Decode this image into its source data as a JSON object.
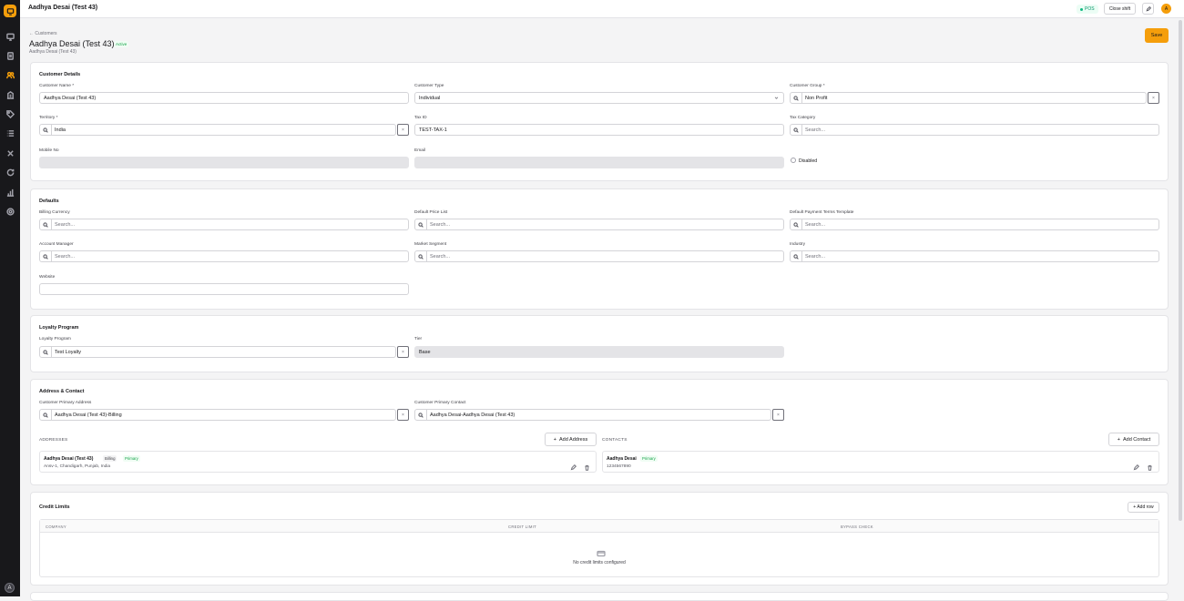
{
  "app": {
    "window_title": "Aadhya Desai (Test 43)",
    "pos_label": "POS",
    "close_shift": "Close shift",
    "avatar_initial": "A",
    "sidebar_avatar_initial": "A"
  },
  "sidebar": {
    "items": [
      "monitor-icon",
      "document-icon",
      "users-icon",
      "building-icon",
      "tag-icon",
      "list-icon",
      "tools-icon",
      "refresh-icon",
      "bar-chart-icon",
      "settings-icon"
    ],
    "active": "users-icon"
  },
  "header": {
    "breadcrumb": "← Customers",
    "title": "Aadhya Desai (Test 43)",
    "status": "Active",
    "subtitle": "Aadhya Desai (Test 43)",
    "save_label": "Save"
  },
  "customer_details": {
    "title": "Customer Details",
    "customer_name_label": "Customer Name *",
    "customer_name_value": "Aadhya Desai (Test 43)",
    "customer_type_label": "Customer Type",
    "customer_type_value": "Individual",
    "customer_group_label": "Customer Group *",
    "customer_group_value": "Non Profit",
    "territory_label": "Territory *",
    "territory_value": "India",
    "tax_id_label": "Tax ID",
    "tax_id_value": "TEST-TAX-1",
    "tax_category_label": "Tax Category",
    "tax_category_placeholder": "Search...",
    "mobile_label": "Mobile No",
    "email_label": "Email",
    "disabled_label": "Disabled"
  },
  "defaults": {
    "title": "Defaults",
    "billing_currency_label": "Billing Currency",
    "default_price_list_label": "Default Price List",
    "payment_terms_label": "Default Payment Terms Template",
    "account_manager_label": "Account Manager",
    "market_segment_label": "Market Segment",
    "industry_label": "Industry",
    "website_label": "Website",
    "placeholder": "Search..."
  },
  "loyalty": {
    "title": "Loyalty Program",
    "program_label": "Loyalty Program",
    "program_value": "Test Loyalty",
    "tier_label": "Tier",
    "tier_value": "Base"
  },
  "address_contact": {
    "title": "Address & Contact",
    "primary_address_label": "Customer Primary Address",
    "primary_address_value": "Aadhya Desai (Test 43)-Billing",
    "primary_contact_label": "Customer Primary Contact",
    "primary_contact_value": "Aadhya Desai-Aadhya Desai (Test 43)",
    "addresses_heading": "ADDRESSES",
    "add_address": "Add Address",
    "contacts_heading": "CONTACTS",
    "add_contact": "Add Contact",
    "address_card": {
      "name": "Aadhya Desai (Test 43)",
      "type": "Billing",
      "badge": "Primary",
      "line": "Ansv-1, Chandigarh, Punjab, India"
    },
    "contact_card": {
      "name": "Aadhya Desai",
      "badge": "Primary",
      "phone": "1234567890"
    }
  },
  "credit_limits": {
    "title": "Credit Limits",
    "add_row": "+ Add row",
    "columns": [
      "COMPANY",
      "CREDIT LIMIT",
      "BYPASS CHECK"
    ],
    "empty": "No credit limits configured"
  }
}
